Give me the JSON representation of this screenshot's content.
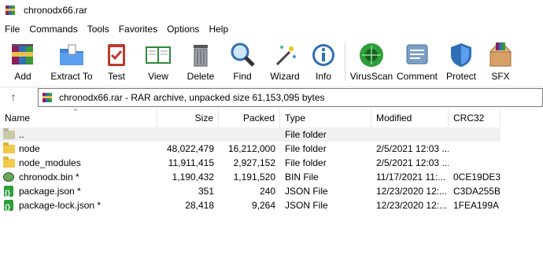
{
  "window": {
    "title": "chronodx66.rar"
  },
  "menu": [
    "File",
    "Commands",
    "Tools",
    "Favorites",
    "Options",
    "Help"
  ],
  "toolbar": [
    {
      "label": "Add",
      "icon": "add-archive-icon"
    },
    {
      "label": "Extract To",
      "icon": "extract-folder-icon"
    },
    {
      "label": "Test",
      "icon": "test-clipboard-icon"
    },
    {
      "label": "View",
      "icon": "view-book-icon"
    },
    {
      "label": "Delete",
      "icon": "trash-icon"
    },
    {
      "label": "Find",
      "icon": "magnifier-icon"
    },
    {
      "label": "Wizard",
      "icon": "magic-wand-icon"
    },
    {
      "label": "Info",
      "icon": "info-icon"
    },
    {
      "label": "VirusScan",
      "icon": "virus-scan-icon"
    },
    {
      "label": "Comment",
      "icon": "comment-icon"
    },
    {
      "label": "Protect",
      "icon": "shield-icon"
    },
    {
      "label": "SFX",
      "icon": "sfx-box-icon"
    }
  ],
  "address": {
    "text": "chronodx66.rar - RAR archive, unpacked size 61,153,095 bytes"
  },
  "columns": {
    "name": "Name",
    "size": "Size",
    "packed": "Packed",
    "type": "Type",
    "modified": "Modified",
    "crc": "CRC32"
  },
  "rows": [
    {
      "name": "..",
      "size": "",
      "packed": "",
      "type": "File folder",
      "modified": "",
      "crc": "",
      "icon": "parent-folder-icon"
    },
    {
      "name": "node",
      "size": "48,022,479",
      "packed": "16,212,000",
      "type": "File folder",
      "modified": "2/5/2021 12:03 ...",
      "crc": "",
      "icon": "folder-icon"
    },
    {
      "name": "node_modules",
      "size": "11,911,415",
      "packed": "2,927,152",
      "type": "File folder",
      "modified": "2/5/2021 12:03 ...",
      "crc": "",
      "icon": "folder-icon"
    },
    {
      "name": "chronodx.bin *",
      "size": "1,190,432",
      "packed": "1,191,520",
      "type": "BIN File",
      "modified": "11/17/2021 11:...",
      "crc": "0CE19DE3",
      "icon": "bin-file-icon"
    },
    {
      "name": "package.json *",
      "size": "351",
      "packed": "240",
      "type": "JSON File",
      "modified": "12/23/2020 12:...",
      "crc": "C3DA255B",
      "icon": "json-file-icon"
    },
    {
      "name": "package-lock.json *",
      "size": "28,418",
      "packed": "9,264",
      "type": "JSON File",
      "modified": "12/23/2020 12:...",
      "crc": "1FEA199A",
      "icon": "json-file-icon"
    }
  ]
}
